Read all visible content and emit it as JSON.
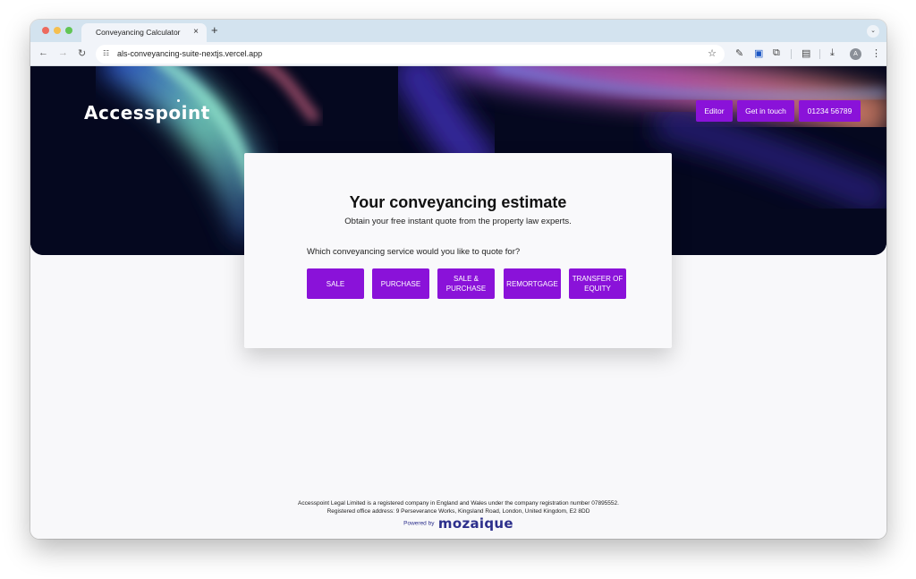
{
  "browser": {
    "tab_title": "Conveyancing Calculator",
    "tab_close": "×",
    "new_tab": "+",
    "tab_dropdown": "⌄",
    "url": "als-conveyancing-suite-nextjs.vercel.app",
    "avatar_initial": "A"
  },
  "header": {
    "logo_text": "Accesspoint",
    "buttons": [
      {
        "label": "Editor"
      },
      {
        "label": "Get in touch"
      },
      {
        "label": "01234 56789"
      }
    ]
  },
  "card": {
    "title": "Your conveyancing estimate",
    "subtitle": "Obtain your free instant quote from the property law experts.",
    "question": "Which conveyancing service would you like to quote for?",
    "services": [
      {
        "label": "SALE"
      },
      {
        "label": "PURCHASE"
      },
      {
        "label": "SALE & PURCHASE"
      },
      {
        "label": "REMORTGAGE"
      },
      {
        "label": "TRANSFER OF EQUITY"
      }
    ]
  },
  "footer": {
    "line1": "Accesspoint Legal Limited is a registered company in England and Wales under the company registration number 07895552.",
    "line2": "Registered office address: 9 Perseverance Works, Kingsland Road, London, United Kingdom, E2 8DD",
    "powered_by": "Powered by",
    "brand": "mozaique"
  },
  "colors": {
    "accent": "#8a12d9",
    "hero_bg": "#05081f",
    "brand_navy": "#2c2f8c"
  }
}
